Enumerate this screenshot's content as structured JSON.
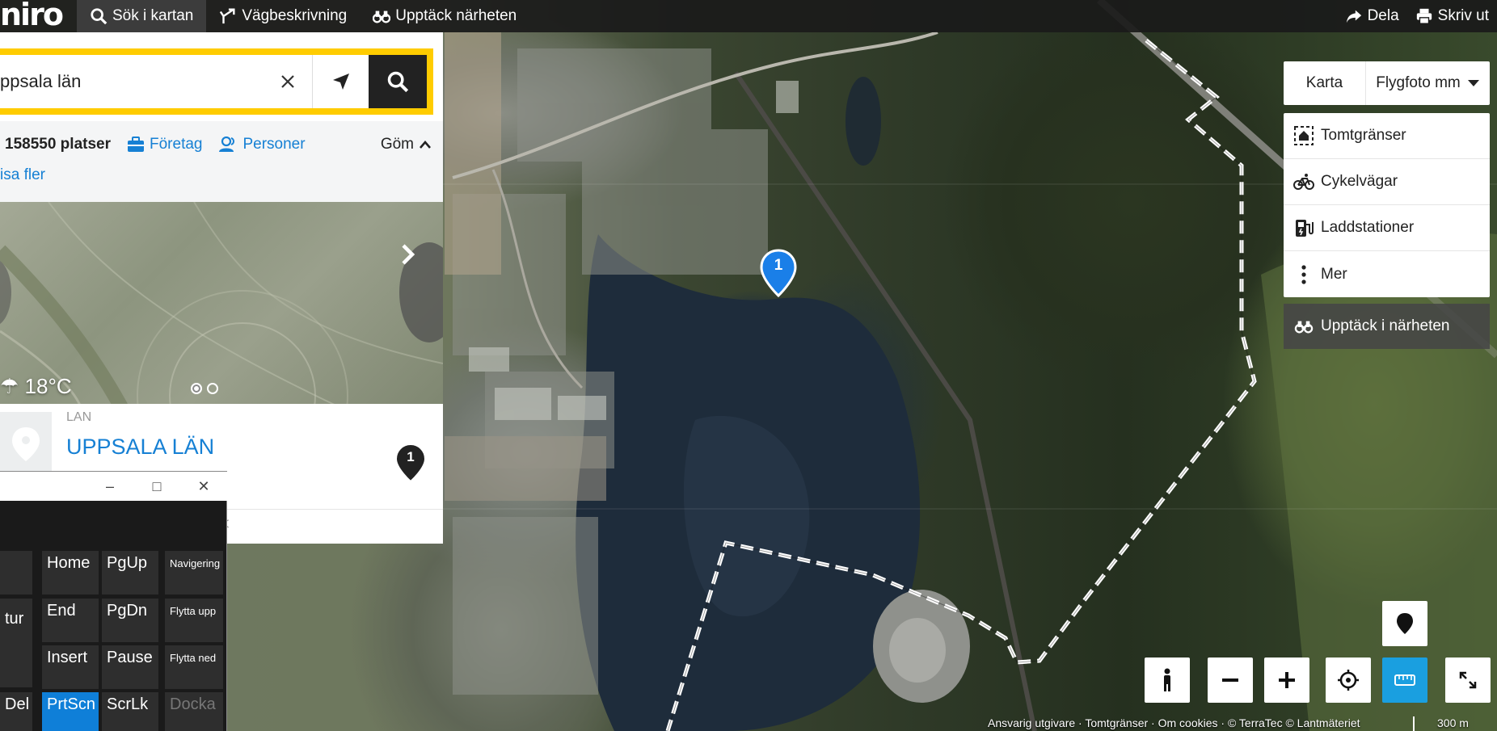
{
  "topbar": {
    "logo": "niro",
    "search_tab": "Sök i kartan",
    "directions_tab": "Vägbeskrivning",
    "discover_tab": "Upptäck närheten",
    "share": "Dela",
    "print": "Skriv ut"
  },
  "search": {
    "value": "ppsala län"
  },
  "results": {
    "count": "158550 platser",
    "companies": "Företag",
    "people": "Personer",
    "hide": "Göm",
    "show_more": "isa fler"
  },
  "photo": {
    "temperature": "18°C"
  },
  "result_item": {
    "type": "LAN",
    "name": "UPPSALA LÄN",
    "badge": "1",
    "footer": "<"
  },
  "map": {
    "marker_number": "1",
    "attribution": "Ansvarig utgivare · Tomtgränser · Om cookies · © TerraTec © Lantmäteriet",
    "scale": "300 m"
  },
  "map_type": {
    "map": "Karta",
    "aerial": "Flygfoto mm"
  },
  "layers": [
    {
      "label": "Tomtgränser",
      "icon": "house-boundary-icon"
    },
    {
      "label": "Cykelvägar",
      "icon": "bicycle-icon"
    },
    {
      "label": "Laddstationer",
      "icon": "charging-station-icon"
    },
    {
      "label": "Mer",
      "icon": "more-vertical-icon"
    }
  ],
  "discover_button": "Upptäck i närheten",
  "keyboard": {
    "minimize": "–",
    "maximize": "□",
    "close": "✕",
    "keys": {
      "home": "Home",
      "pgup": "PgUp",
      "nav": "Navigering",
      "tur": "tur",
      "end": "End",
      "pgdn": "PgDn",
      "moveup": "Flytta upp",
      "insert": "Insert",
      "pause": "Pause",
      "movedown": "Flytta ned",
      "del": "Del",
      "prtscn": "PrtScn",
      "scrlk": "ScrLk",
      "dock": "Docka"
    }
  },
  "colors": {
    "accent": "#1680d4",
    "search_border": "#ffcc00",
    "topbar": "#1a1a1a",
    "active_control": "#1a9fe0"
  }
}
